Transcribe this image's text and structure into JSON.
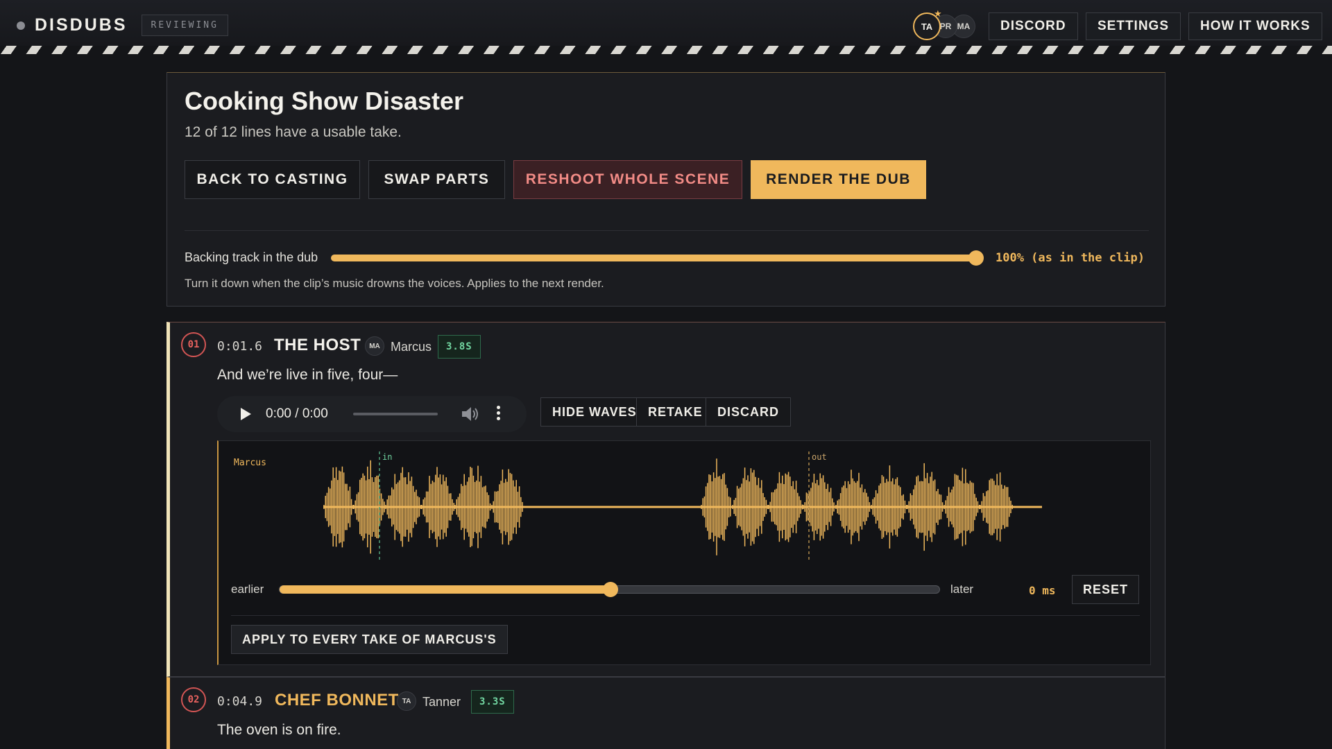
{
  "app": {
    "name": "DISDUBS",
    "mode": "REVIEWING"
  },
  "nav": {
    "collaborators": [
      "TA",
      "PR",
      "MA"
    ],
    "discord": "DISCORD",
    "settings": "SETTINGS",
    "how_it_works": "HOW IT WORKS"
  },
  "scene": {
    "title": "Cooking Show Disaster",
    "status": "12 of 12 lines have a usable take.",
    "buttons": {
      "back": "BACK TO CASTING",
      "swap": "SWAP PARTS",
      "reshoot": "RESHOOT WHOLE SCENE",
      "render": "RENDER THE DUB"
    },
    "backing": {
      "label": "Backing track in the dub",
      "percent": 100,
      "value_text": "100% (as in the clip)",
      "hint": "Turn it down when the clip’s music drowns the voices. Applies to the next render."
    }
  },
  "lines": [
    {
      "number": "01",
      "timestamp": "0:01.6",
      "role": "THE HOST",
      "actor_initials": "MA",
      "actor": "Marcus",
      "duration": "3.8S",
      "text": "And we’re live in five, four—",
      "player": {
        "time": "0:00 / 0:00"
      },
      "actions": {
        "hide_waves": "HIDE WAVES",
        "retake": "RETAKE",
        "discard": "DISCARD"
      },
      "waveform": {
        "actor_label": "Marcus",
        "in_label": "in",
        "out_label": "out",
        "earlier": "earlier",
        "later": "later",
        "offset_fraction": 0.5,
        "offset_text": "0 ms",
        "reset": "RESET",
        "apply_all": "APPLY TO EVERY TAKE OF MARCUS'S"
      }
    },
    {
      "number": "02",
      "timestamp": "0:04.9",
      "role": "CHEF BONNET",
      "actor_initials": "TA",
      "actor": "Tanner",
      "duration": "3.3S",
      "text": "The oven is on fire."
    }
  ],
  "colors": {
    "accent": "#f0b85c",
    "danger": "#f28b86",
    "success": "#72d6a1",
    "background": "#141518",
    "panel": "#1b1c20"
  }
}
